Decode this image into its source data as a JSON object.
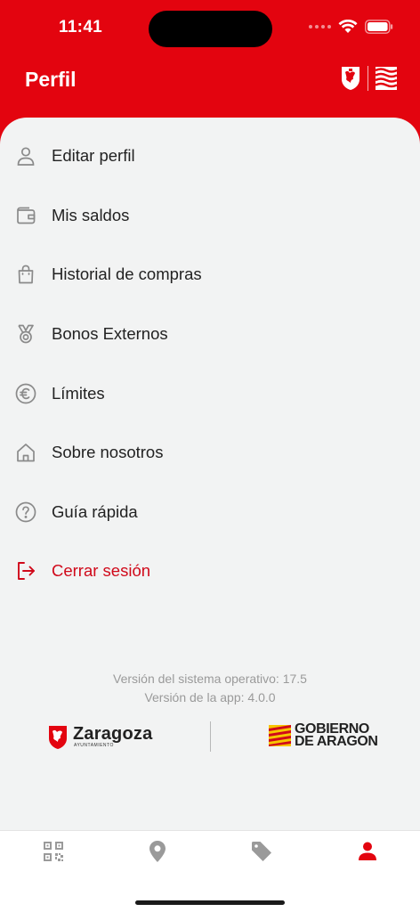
{
  "status_bar": {
    "time": "11:41"
  },
  "header": {
    "title": "Perfil"
  },
  "menu": [
    {
      "label": "Editar perfil",
      "icon": "user-icon"
    },
    {
      "label": "Mis saldos",
      "icon": "wallet-icon"
    },
    {
      "label": "Historial de compras",
      "icon": "shopping-bag-icon"
    },
    {
      "label": "Bonos Externos",
      "icon": "medal-icon"
    },
    {
      "label": "Límites",
      "icon": "euro-icon"
    },
    {
      "label": "Sobre nosotros",
      "icon": "home-icon"
    },
    {
      "label": "Guía rápida",
      "icon": "help-icon"
    },
    {
      "label": "Cerrar sesión",
      "icon": "logout-icon"
    }
  ],
  "versions": {
    "os": "Versión del sistema operativo: 17.5",
    "app": "Versión de la app: 4.0.0"
  },
  "footer": {
    "zaragoza_name": "Zaragoza",
    "zaragoza_sub": "AYUNTAMIENTO",
    "aragon_line1": "GOBIERNO",
    "aragon_line2": "DE ARAGON"
  },
  "tabs": [
    {
      "icon": "qr-code-icon",
      "active": false
    },
    {
      "icon": "location-pin-icon",
      "active": false
    },
    {
      "icon": "tag-icon",
      "active": false
    },
    {
      "icon": "profile-icon",
      "active": true
    }
  ],
  "colors": {
    "brand_red": "#e3040f",
    "logout_red": "#d0091a",
    "icon_gray": "#8a8a8a",
    "background": "#f2f3f3"
  }
}
